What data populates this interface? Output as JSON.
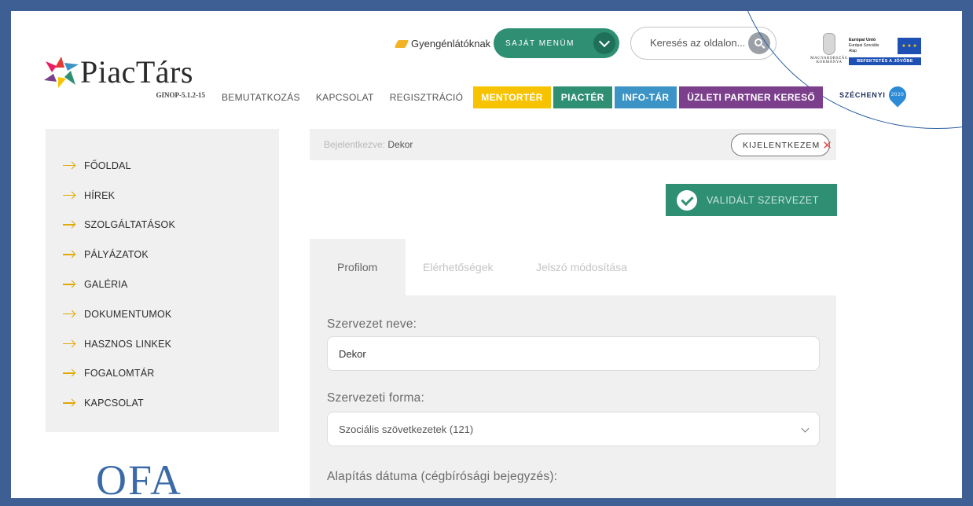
{
  "header": {
    "logo_text": "PiacTárs",
    "logo_sub": "GINOP-5.1.2-15",
    "gyengenlatok": "Gyengénlátóknak",
    "sajat_menum": "SAJÁT MENÜM",
    "search_placeholder": "Keresés az oldalon...",
    "gov_text": "MAGYARORSZÁG KORMÁNYA",
    "eu_title": "Európai Unió",
    "eu_sub1": "Európai Szociális",
    "eu_sub2": "Alap",
    "eu_band": "BEFEKTETÉS A JÖVŐBE",
    "szechenyi": "SZÉCHENYI",
    "szechenyi_year": "2020"
  },
  "nav": {
    "items": [
      {
        "label": "BEMUTATKOZÁS"
      },
      {
        "label": "KAPCSOLAT"
      },
      {
        "label": "REGISZTRÁCIÓ"
      },
      {
        "label": "MENTORTÉR"
      },
      {
        "label": "PIACTÉR"
      },
      {
        "label": "INFO-TÁR"
      },
      {
        "label": "ÜZLETI PARTNER KERESŐ"
      }
    ],
    "colors": {
      "mentor": "#f7c300",
      "piac": "#2f8f72",
      "info": "#3c93c6",
      "uzleti": "#7b3f8c"
    }
  },
  "sidebar": {
    "items": [
      {
        "label": "FŐOLDAL"
      },
      {
        "label": "HÍREK"
      },
      {
        "label": "SZOLGÁLTATÁSOK"
      },
      {
        "label": "PÁLYÁZATOK"
      },
      {
        "label": "GALÉRIA"
      },
      {
        "label": "DOKUMENTUMOK"
      },
      {
        "label": "HASZNOS LINKEK"
      },
      {
        "label": "FOGALOMTÁR"
      },
      {
        "label": "KAPCSOLAT"
      }
    ],
    "ofa_logo": "OFA"
  },
  "session": {
    "logged_label": "Bejelentkezve:",
    "logged_user": "Dekor",
    "logout_label": "KIJELENTKEZEM",
    "validated_label": "VALIDÁLT SZERVEZET"
  },
  "tabs": [
    {
      "label": "Profilom"
    },
    {
      "label": "Elérhetőségek"
    },
    {
      "label": "Jelszó módosítása"
    }
  ],
  "form": {
    "org_name_label": "Szervezet neve:",
    "org_name_value": "Dekor",
    "org_form_label": "Szervezeti forma:",
    "org_form_value": "Szociális szövetkezetek (121)",
    "founding_label": "Alapítás dátuma (cégbírósági bejegyzés):"
  }
}
